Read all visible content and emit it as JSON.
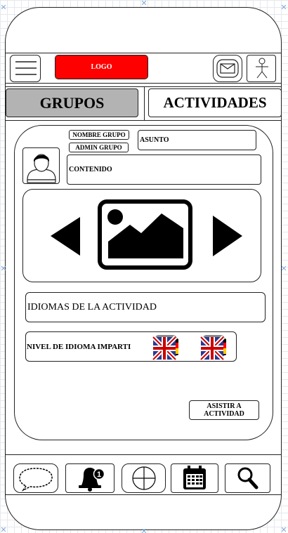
{
  "header": {
    "logo_text": "LOGO",
    "menu_icon": "hamburger-icon",
    "mail_icon": "envelope-icon",
    "user_icon": "stick-figure-icon"
  },
  "tabs": [
    {
      "label": "GRUPOS",
      "selected": true
    },
    {
      "label": "ACTIVIDADES",
      "selected": false
    }
  ],
  "card": {
    "group_name": "NOMBRE GRUPO",
    "group_admin": "ADMIN GRUPO",
    "subject": "ASUNTO",
    "content": "CONTENIDO",
    "languages_label": "IDIOMAS DE LA ACTIVIDAD",
    "level_label": "NIVEL DE IDIOMA IMPARTI",
    "attend_button": "ASISTIR A ACTIVIDAD",
    "flags": [
      "uk-flag-icon",
      "uk-flag-icon"
    ],
    "carousel": {
      "prev_icon": "triangle-left-icon",
      "image_icon": "image-placeholder-icon",
      "next_icon": "triangle-right-icon"
    }
  },
  "bottom_nav": [
    {
      "name": "chat-icon"
    },
    {
      "name": "notification-bell-icon",
      "badge": "1"
    },
    {
      "name": "crosshair-icon"
    },
    {
      "name": "calendar-icon"
    },
    {
      "name": "search-icon"
    }
  ],
  "colors": {
    "logo_bg": "#ff0000",
    "selected_tab_bg": "#b3b3b3",
    "outline": "#222222"
  }
}
